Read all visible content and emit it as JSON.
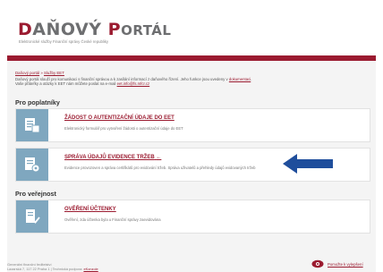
{
  "header": {
    "logo_main": "DAŇOVÝ",
    "logo_p": "P",
    "logo_rest": "ORTÁL",
    "tagline": "Elektronické služby Finanční správy České republiky"
  },
  "breadcrumb": {
    "item1": "Daňový portál",
    "sep": " » ",
    "item2": "Služby EET"
  },
  "intro": {
    "line1_a": "Daňový portál slouží pro komunikaci s finanční správou a k zasílání informací z daňového řízení. Jeho funkce jsou uvedeny v",
    "line1_link": "dokumentaci",
    "line2_a": "Vaše přáteľky a otázky k EET nám můžete poslat na e-mail",
    "line2_link": "eet.info@fs.mfcr.cz"
  },
  "sections": {
    "poplatnik": "Pro poplatníky",
    "verejnost": "Pro veřejnost"
  },
  "cards": [
    {
      "title": "ŽÁDOST O AUTENTIZAČNÍ ÚDAJE DO EET",
      "desc": "Elektronický formulář pro vytvoření žádosti o autentizační údaje do EET"
    },
    {
      "title": "SPRÁVA ÚDAJŮ EVIDENCE TRŽEB",
      "desc": "Evidence provozoven a správa certifikátů pro evidování tržeb. Správa uživatelů a přehledy údajů evidovaných tržeb"
    },
    {
      "title": "OVĚŘENÍ ÚČTENKY",
      "desc": "Ověření, zda účtenka byla u Finanční správy zaevidována"
    }
  ],
  "footer": {
    "line1": "Generální finanční ředitelství",
    "line2_a": "Lazarská 7, 117 22 Praha 1 | Technická podpora:",
    "line2_link": "eKonzole",
    "feedback": "Pomožte k vylepšení"
  },
  "colors": {
    "brand": "#9b1b30",
    "icon_tile": "#7fa7bf",
    "annotation_arrow": "#1f4e9c"
  }
}
